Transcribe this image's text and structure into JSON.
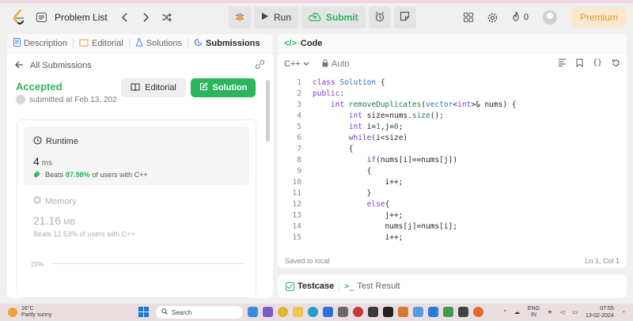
{
  "nav": {
    "problem_list": "Problem List",
    "run": "Run",
    "submit": "Submit",
    "streak_count": "0",
    "premium": "Premium"
  },
  "left_tabs": [
    {
      "label": "Description",
      "icon": "description-icon"
    },
    {
      "label": "Editorial",
      "icon": "editorial-icon"
    },
    {
      "label": "Solutions",
      "icon": "solutions-icon"
    },
    {
      "label": "Submissions",
      "icon": "submissions-icon"
    }
  ],
  "submission": {
    "back_label": "All Submissions",
    "status": "Accepted",
    "submitted_at": "submitted at Feb 13, 202",
    "editorial_btn": "Editorial",
    "solution_btn": "Solution",
    "runtime_title": "Runtime",
    "runtime_value": "4",
    "runtime_unit": "ms",
    "runtime_beats_prefix": "Beats",
    "runtime_beats_pct": "87.98%",
    "runtime_beats_suffix": "of users with C++",
    "memory_title": "Memory",
    "memory_value": "21.16",
    "memory_unit": "MB",
    "memory_beats_prefix": "Beats",
    "memory_beats_pct": "12.53%",
    "memory_beats_suffix": "of users with C++",
    "chart_pct_label": "20%"
  },
  "code": {
    "title": "Code",
    "language": "C++",
    "mode": "Auto",
    "status": "Saved to local",
    "position": "Ln 1, Col 1",
    "lines": [
      {
        "n": "1",
        "text": "class Solution {"
      },
      {
        "n": "2",
        "text": "public:"
      },
      {
        "n": "3",
        "text": "    int removeDuplicates(vector<int>& nums) {"
      },
      {
        "n": "4",
        "text": "        int size=nums.size();"
      },
      {
        "n": "5",
        "text": "        int i=1,j=0;"
      },
      {
        "n": "6",
        "text": "        while(i<size)"
      },
      {
        "n": "7",
        "text": "        {"
      },
      {
        "n": "8",
        "text": "            if(nums[i]==nums[j])"
      },
      {
        "n": "9",
        "text": "            {"
      },
      {
        "n": "10",
        "text": "                i++;"
      },
      {
        "n": "11",
        "text": "            }"
      },
      {
        "n": "12",
        "text": "            else{"
      },
      {
        "n": "13",
        "text": "                j++;"
      },
      {
        "n": "14",
        "text": "                nums[j]=nums[i];"
      },
      {
        "n": "15",
        "text": "                i++;"
      }
    ]
  },
  "test": {
    "testcase": "Testcase",
    "result": "Test Result"
  },
  "taskbar": {
    "temp": "16°C",
    "weather": "Partly sunny",
    "search": "Search",
    "lang": "ENG",
    "region": "IN",
    "time": "07:55",
    "date": "13-02-2024"
  }
}
